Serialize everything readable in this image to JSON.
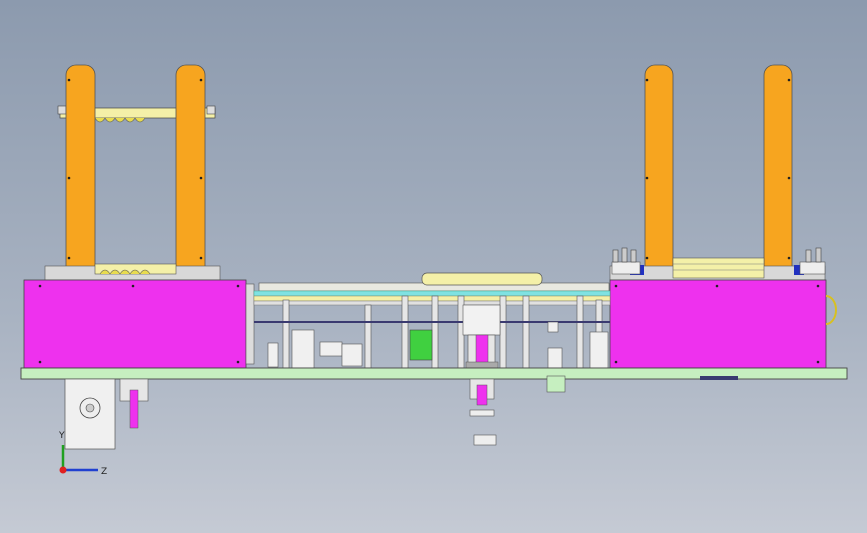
{
  "view": {
    "name": "cad-assembly-front-view"
  },
  "axes": {
    "x_label": "X",
    "y_label": "Y",
    "z_label": "Z"
  },
  "colors": {
    "post": "#f7a51f",
    "housing": "#ee31ee",
    "base_plate": "#c6efc0",
    "rail_cyan": "#7fe2e2",
    "rail_yellow": "#f4f0a8",
    "frame": "#e6e6e6",
    "outline": "#333333"
  }
}
